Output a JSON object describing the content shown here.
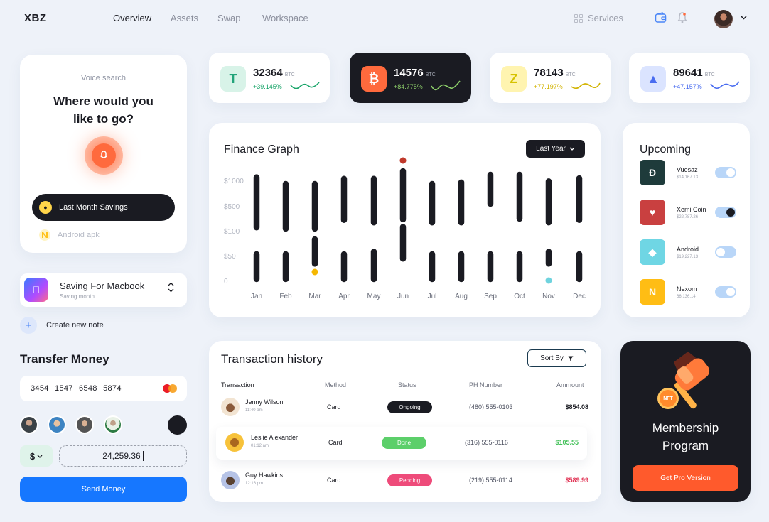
{
  "header": {
    "logo": "XBZ",
    "nav": [
      "Overview",
      "Assets",
      "Swap",
      "Workspace"
    ],
    "services": "Services"
  },
  "voice": {
    "label": "Voice search",
    "title": "Where would you like to go?",
    "savings": "Last Month Savings",
    "apk": "Android apk"
  },
  "macbook": {
    "title": "Saving For Macbook",
    "sub": "Saving month"
  },
  "note": {
    "label": "Create new note"
  },
  "transfer": {
    "title": "Transfer Money",
    "card_number": "3454 1547 6548 5874",
    "currency": "$",
    "amount": "24,259.36",
    "send": "Send Money"
  },
  "coins": [
    {
      "value": "32364",
      "unit": "BTC",
      "pct": "+39.145%",
      "pct_color": "#1aa56a",
      "spark_color": "#1aa56a",
      "icon": "tether-icon",
      "bg": "#d8f3e8",
      "fg": "#23a47a"
    },
    {
      "value": "14576",
      "unit": "BTC",
      "pct": "+84.775%",
      "pct_color": "#8ed06a",
      "spark_color": "#8ed06a",
      "icon": "bitcoin-icon",
      "bg": "#ff6a3d",
      "fg": "#ffffff"
    },
    {
      "value": "78143",
      "unit": "BTC",
      "pct": "+77.197%",
      "pct_color": "#d2b300",
      "spark_color": "#d2b300",
      "icon": "zcash-icon",
      "bg": "#fff4b0",
      "fg": "#d6c200"
    },
    {
      "value": "89641",
      "unit": "BTC",
      "pct": "+47.157%",
      "pct_color": "#4a6df0",
      "spark_color": "#4a6df0",
      "icon": "triangle-coin-icon",
      "bg": "#dbe4ff",
      "fg": "#4a6df0"
    }
  ],
  "finance": {
    "title": "Finance Graph",
    "filter": "Last Year"
  },
  "chart_data": {
    "type": "bar",
    "title": "Finance Graph",
    "categories": [
      "Jan",
      "Feb",
      "Mar",
      "Apr",
      "May",
      "Jun",
      "Jul",
      "Aug",
      "Sep",
      "Oct",
      "Nov",
      "Dec"
    ],
    "y_ticks": [
      "$1000",
      "$500",
      "$100",
      "$50",
      "0"
    ],
    "upper_range": [
      [
        120,
        1130
      ],
      [
        100,
        1000
      ],
      [
        100,
        1000
      ],
      [
        240,
        1100
      ],
      [
        200,
        1100
      ],
      [
        250,
        1250
      ],
      [
        200,
        1000
      ],
      [
        200,
        1030
      ],
      [
        500,
        1180
      ],
      [
        260,
        1180
      ],
      [
        200,
        1050
      ],
      [
        240,
        1110
      ]
    ],
    "lower_range": [
      [
        0,
        60
      ],
      [
        0,
        60
      ],
      [
        30,
        90
      ],
      [
        0,
        60
      ],
      [
        0,
        65
      ],
      [
        40,
        220
      ],
      [
        0,
        60
      ],
      [
        0,
        60
      ],
      [
        0,
        60
      ],
      [
        0,
        60
      ],
      [
        30,
        65
      ],
      [
        0,
        60
      ]
    ],
    "markers": [
      {
        "category": "Jun",
        "value": 1260,
        "color": "#c0392b"
      },
      {
        "category": "Mar",
        "value": 10,
        "color": "#f5b700"
      },
      {
        "category": "Nov",
        "value": 0,
        "color": "#6fd3de"
      }
    ]
  },
  "upcoming": {
    "title": "Upcoming",
    "items": [
      {
        "name": "Vuesaz",
        "sub": "$14,167.13",
        "icon": "dash-icon",
        "bg": "#1e3b3b",
        "on": true
      },
      {
        "name": "Xemi Coin",
        "sub": "$22,787.26",
        "icon": "heart-coin-icon",
        "bg": "#c94040",
        "on": true
      },
      {
        "name": "Android",
        "sub": "$19,227.13",
        "icon": "android-icon",
        "bg": "#6fd6e4",
        "on": false
      },
      {
        "name": "Nexom",
        "sub": "66,136.14",
        "icon": "nexom-icon",
        "bg": "#ffbd14",
        "on": true
      }
    ]
  },
  "transactions": {
    "title": "Transaction history",
    "sort": "Sort By",
    "columns": [
      "Transaction",
      "Method",
      "Status",
      "PH Number",
      "Ammount"
    ],
    "rows": [
      {
        "name": "Jenny Wilson",
        "time": "11:40 am",
        "method": "Card",
        "status": "Ongoing",
        "status_color": "#1a1b22",
        "phone": "(480) 555-0103",
        "amount": "$854.08",
        "amount_color": "#1a1b22",
        "avatar_bg": "#f2e4d2"
      },
      {
        "name": "Leslie Alexander",
        "time": "01:12 am",
        "method": "Card",
        "status": "Done",
        "status_color": "#5ccf6a",
        "phone": "(316) 555-0116",
        "amount": "$105.55",
        "amount_color": "#44c15a",
        "avatar_bg": "#f7c23a"
      },
      {
        "name": "Guy Hawkins",
        "time": "12:16 pm",
        "method": "Card",
        "status": "Pending",
        "status_color": "#ee4b7a",
        "phone": "(219) 555-0114",
        "amount": "$589.99",
        "amount_color": "#e23a5a",
        "avatar_bg": "#b6c3e6"
      }
    ]
  },
  "membership": {
    "title": "Membership Program",
    "badge": "NFT",
    "button": "Get Pro Version"
  }
}
